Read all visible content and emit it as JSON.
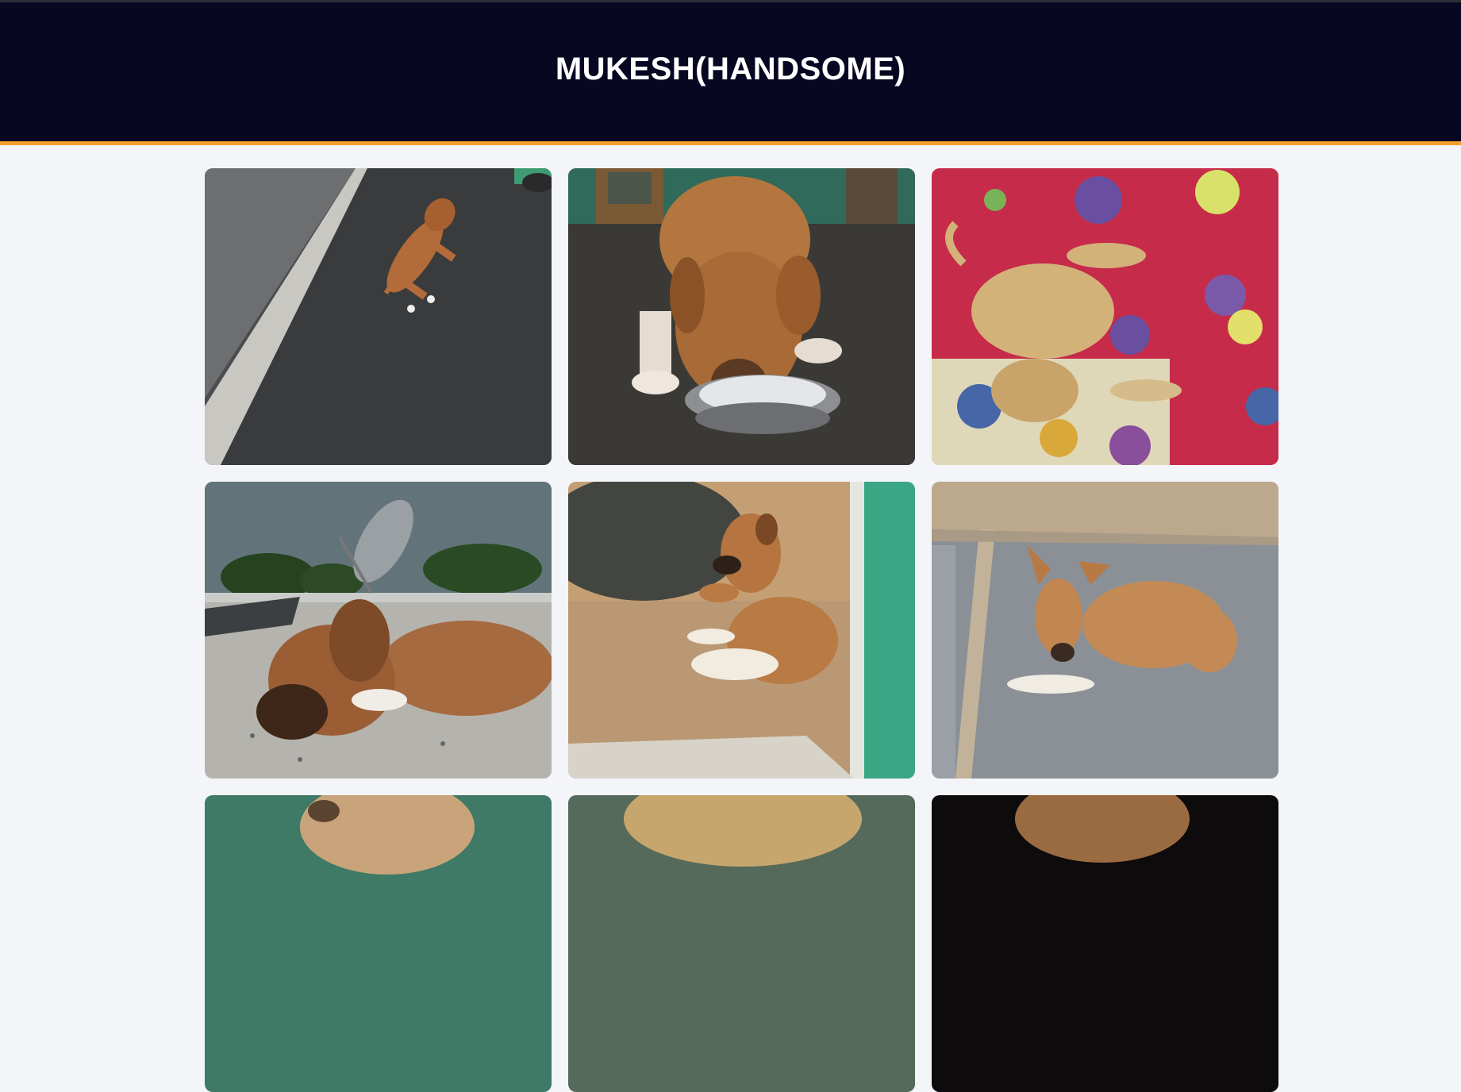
{
  "header": {
    "title": "MUKESH(HANDSOME)"
  },
  "colors": {
    "header_bg": "#070722",
    "accent_border": "#f4a02c",
    "page_bg": "#f3f5f8"
  },
  "gallery": {
    "photos": [
      {
        "subject": "puppy-on-stone-floor"
      },
      {
        "subject": "puppy-drinking-from-bowl"
      },
      {
        "subject": "puppy-sleeping-on-floral-blanket"
      },
      {
        "subject": "puppy-lying-on-rooftop"
      },
      {
        "subject": "dog-resting-by-rock-and-wall"
      },
      {
        "subject": "dog-lying-on-paved-ground"
      },
      {
        "subject": "dog-closeup-partial-1"
      },
      {
        "subject": "dog-closeup-partial-2"
      },
      {
        "subject": "dog-closeup-partial-3"
      }
    ]
  }
}
